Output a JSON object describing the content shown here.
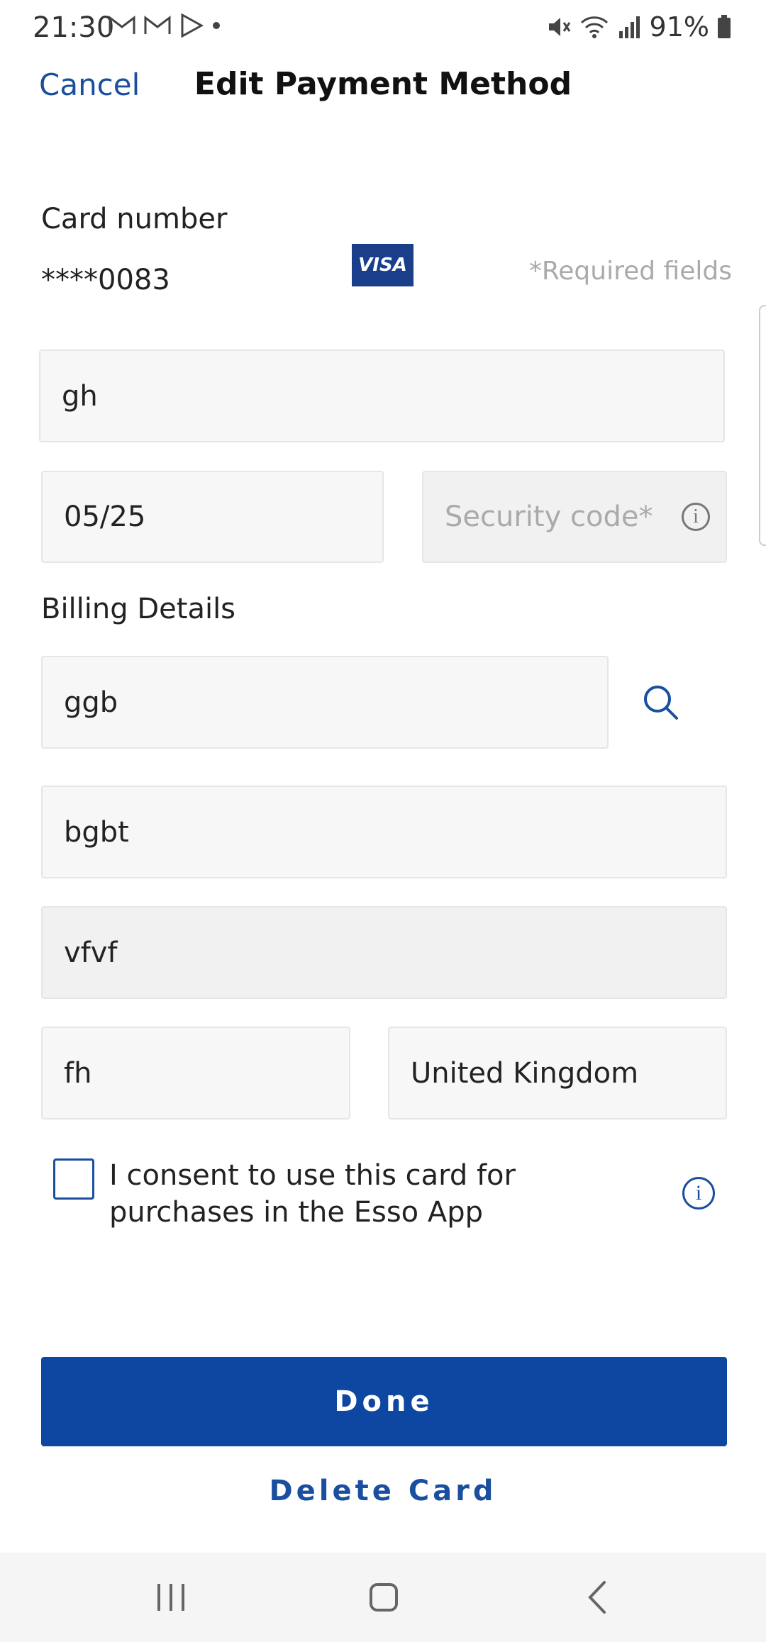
{
  "status_bar": {
    "time": "21:30",
    "battery": "91%"
  },
  "header": {
    "cancel_label": "Cancel",
    "title": "Edit Payment Method"
  },
  "card": {
    "label": "Card number",
    "number": "****0083",
    "brand": "VISA",
    "required_note": "*Required fields"
  },
  "fields": {
    "name": "gh",
    "expiry": "05/25",
    "security_placeholder": "Security code*"
  },
  "billing": {
    "heading": "Billing Details",
    "address_search": "ggb",
    "address_line1": "bgbt",
    "address_line2": "vfvf",
    "postcode": "fh",
    "country": "United Kingdom"
  },
  "consent": {
    "text": "I consent to use this card for purchases in the Esso App"
  },
  "actions": {
    "done_label": "Done",
    "delete_label": "Delete Card"
  },
  "colors": {
    "accent": "#0d47a1",
    "link": "#1a4fa0"
  }
}
